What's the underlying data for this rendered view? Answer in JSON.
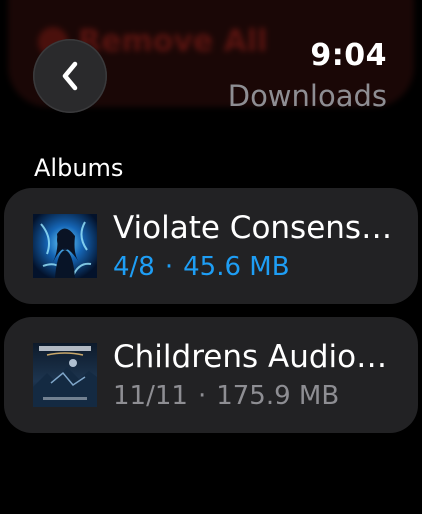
{
  "remove_all": {
    "label": "Remove All",
    "color": "#5a1410"
  },
  "header": {
    "time": "9:04",
    "title": "Downloads",
    "back_icon": "chevron-left-icon"
  },
  "section": {
    "label": "Albums"
  },
  "albums": [
    {
      "title": "Violate Consens…",
      "progress": "4/8",
      "separator": "·",
      "size": "45.6 MB",
      "status": "downloading",
      "status_color": "#1e9ef5"
    },
    {
      "title": "Childrens Audio…",
      "progress": "11/11",
      "separator": "·",
      "size": "175.9 MB",
      "status": "complete",
      "status_color": "#8e8e93"
    }
  ],
  "colors": {
    "background": "#000000",
    "card": "#222224",
    "accent": "#1e9ef5",
    "secondary_text": "#8e8e93"
  }
}
